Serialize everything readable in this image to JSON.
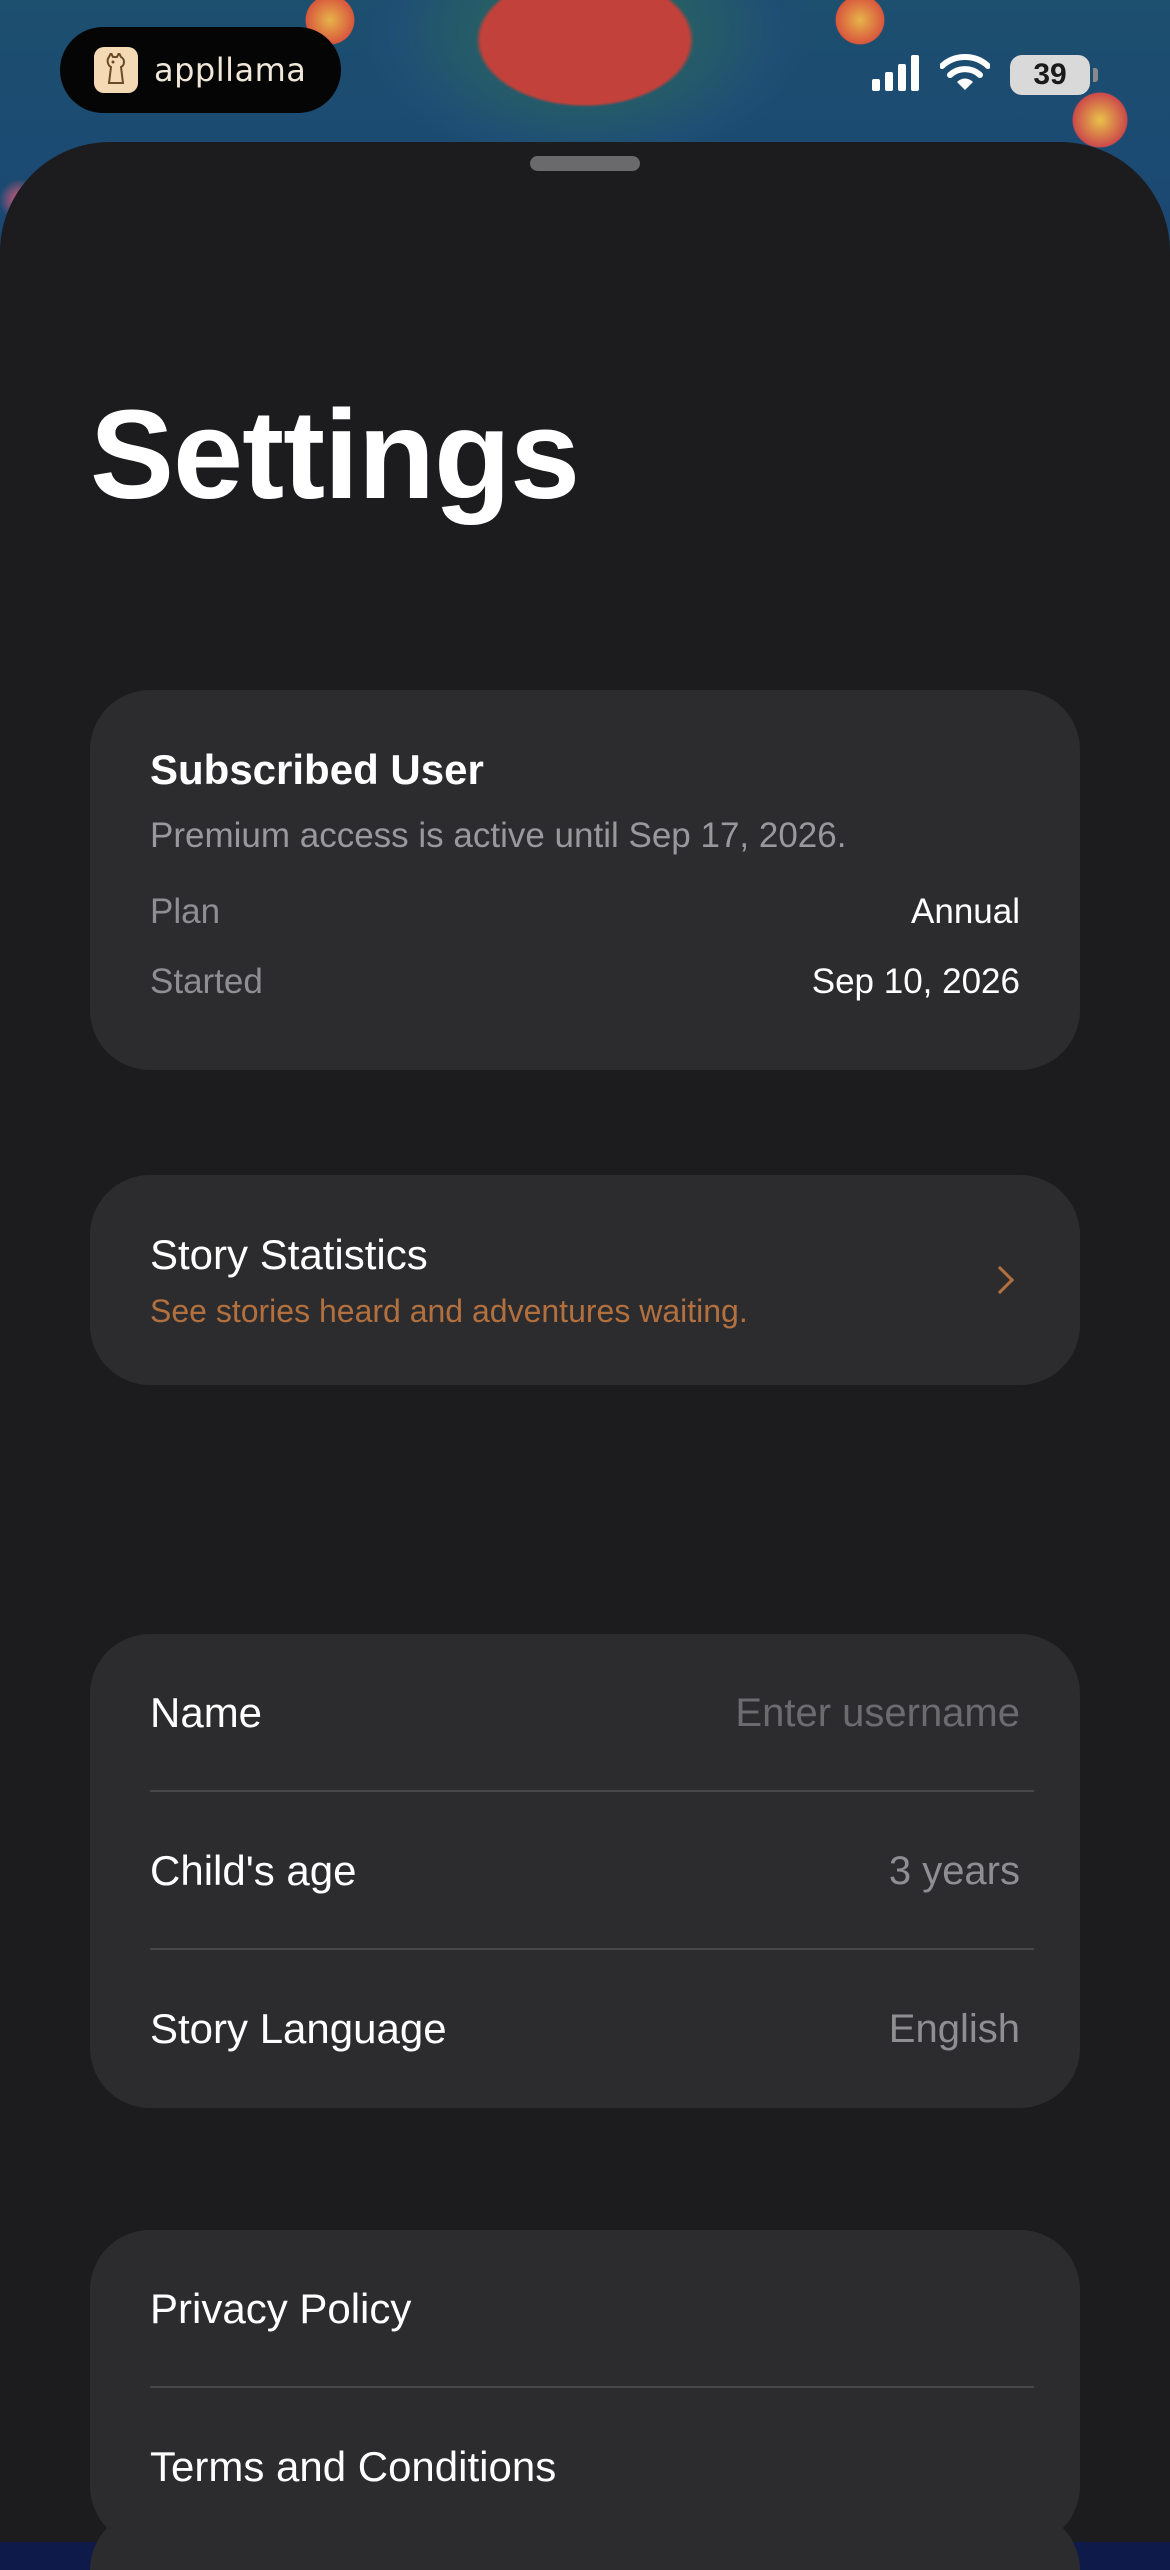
{
  "status_bar": {
    "app_name": "appllama",
    "battery_level": "39",
    "signal_icon": "cellular-signal-icon",
    "wifi_icon": "wifi-icon"
  },
  "page": {
    "title": "Settings"
  },
  "subscription": {
    "title": "Subscribed User",
    "description": "Premium access is active until Sep 17, 2026.",
    "plan_label": "Plan",
    "plan_value": "Annual",
    "started_label": "Started",
    "started_value": "Sep 10, 2026"
  },
  "story_statistics": {
    "title": "Story Statistics",
    "description": "See stories heard and adventures waiting.",
    "accent_color": "#b3703f"
  },
  "profile": {
    "name_label": "Name",
    "name_value": "",
    "name_placeholder": "Enter username",
    "age_label": "Child's age",
    "age_value": "3 years",
    "language_label": "Story Language",
    "language_value": "English"
  },
  "legal": {
    "privacy_label": "Privacy Policy",
    "terms_label": "Terms and Conditions"
  },
  "colors": {
    "sheet_background": "#1c1c1e",
    "card_background": "#2c2c2e",
    "secondary_text": "#8e8e93"
  }
}
